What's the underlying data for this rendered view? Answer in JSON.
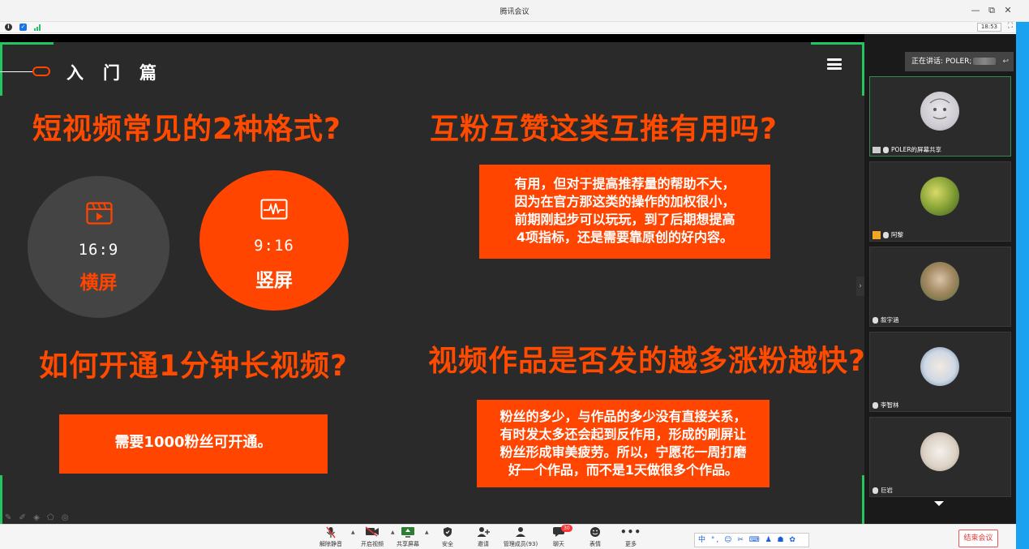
{
  "window": {
    "title": "腾讯会议",
    "minimize": "—",
    "restore": "⧉",
    "close": "✕"
  },
  "infobar": {
    "clock": "18:53",
    "fullscreen_icon": "⛶"
  },
  "slide": {
    "section": "入门篇",
    "q1": "短视频常见的2种格式?",
    "q2": "互粉互赞这类互推有用吗?",
    "q3": "如何开通1分钟长视频?",
    "q4": "视频作品是否发的越多涨粉越快?",
    "format_left": {
      "ratio": "16:9",
      "label": "横屏",
      "icon": "video-clapper-icon",
      "bg": "#444444",
      "label_color": "#ff4500"
    },
    "format_right": {
      "ratio": "9:16",
      "label": "竖屏",
      "icon": "waveform-icon",
      "bg": "#ff4500",
      "label_color": "#ffffff"
    },
    "a2_lines": [
      "有用，但对于提高推荐量的帮助不大，",
      "因为在官方那这类的操作的加权很小，",
      "前期刚起步可以玩玩，到了后期想提高",
      "4项指标，还是需要靠原创的好内容。"
    ],
    "a3": "需要1000粉丝可开通。",
    "a4_lines": [
      "粉丝的多少，与作品的多少没有直接关系，",
      "有时发太多还会起到反作用，形成的刷屏让",
      "粉丝形成审美疲劳。所以，宁愿花一周打磨",
      "好一个作品，而不是1天做很多个作品。"
    ],
    "accent": "#ff4500"
  },
  "panel": {
    "speaking_label": "正在讲话: POLER;",
    "back_icon": "↩",
    "participants": [
      {
        "name": "POLER的屏幕共享",
        "active": true
      },
      {
        "name": "阿黎"
      },
      {
        "name": "叙宇涵"
      },
      {
        "name": "李智林"
      },
      {
        "name": "巨岩"
      }
    ],
    "collapse_icon": "›"
  },
  "toolbar": {
    "mute": "解除静音",
    "video": "开启视频",
    "share": "共享屏幕",
    "security": "安全",
    "invite": "邀请",
    "members": "管理成员(93)",
    "chat": "聊天",
    "chat_badge": "30",
    "emoji": "表情",
    "more": "更多",
    "ime": "中 °, ☺ ✂ ⌨ ♟ ☗ ✿",
    "end": "结束会议"
  }
}
